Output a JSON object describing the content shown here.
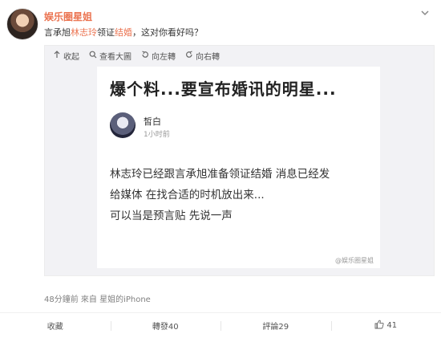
{
  "post": {
    "username": "娱乐圈星姐",
    "text_parts": [
      "言承旭",
      "林志玲",
      "领证",
      "结婚",
      "，这对你看好吗？"
    ],
    "meta": "48分鐘前 來自 星姐的iPhone"
  },
  "toolbar": {
    "collapse": "收起",
    "view_large": "查看大圖",
    "rotate_left": "向左轉",
    "rotate_right": "向右轉"
  },
  "screenshot": {
    "title": "爆个料...要宣布婚讯的明星...",
    "author": "皙白",
    "time": "1小时前",
    "body_lines": [
      "林志玲已经跟言承旭准备领证结婚 消息已经发",
      "给媒体 在找合适的时机放出来...",
      "可以当是预言贴 先说一声"
    ],
    "watermark": "@娱乐圈星姐"
  },
  "actions": {
    "favorite": "收藏",
    "repost": "轉發40",
    "comment": "評論29",
    "like": "41"
  },
  "colors": {
    "accent": "#eb7350",
    "muted": "#808080"
  },
  "icons": [
    "avatar",
    "chevron-down-icon",
    "collapse-icon",
    "zoom-icon",
    "rotate-left-icon",
    "rotate-right-icon",
    "thumbs-up-icon"
  ]
}
